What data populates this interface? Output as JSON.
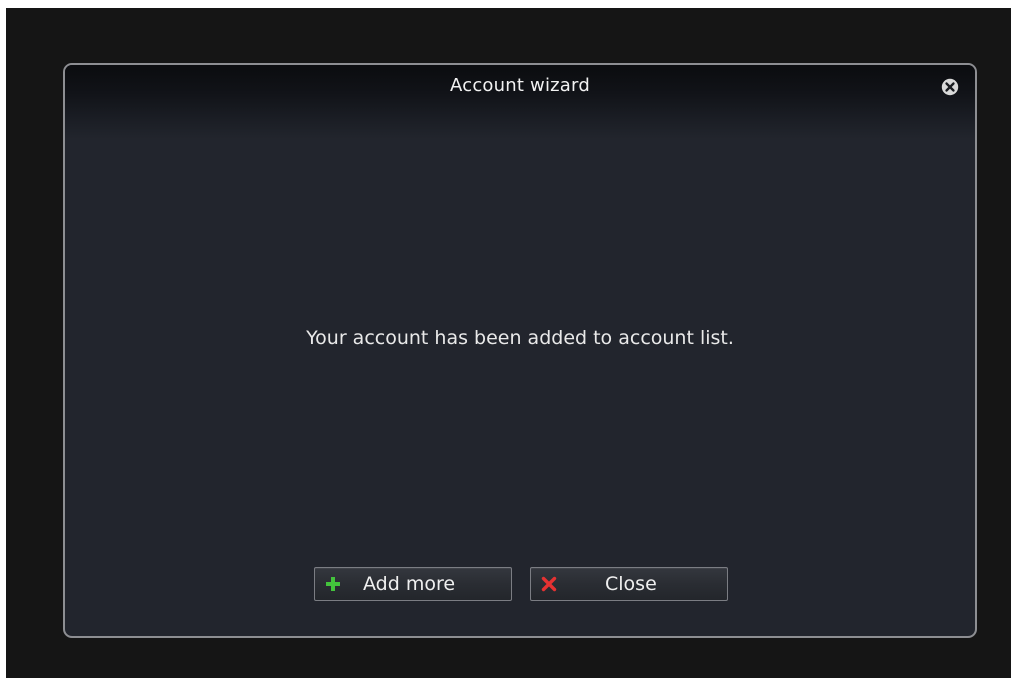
{
  "dialog": {
    "title": "Account wizard",
    "message": "Your account has been added to account list.",
    "buttons": {
      "add_more_label": "Add more",
      "close_label": "Close"
    }
  },
  "icons": {
    "title_close": "close-circle-icon",
    "add": "plus-icon",
    "close": "x-icon"
  },
  "colors": {
    "backdrop": "#151515",
    "dialog_bg": "#22252d",
    "dialog_border": "#8d8e92",
    "plus": "#43c33c",
    "x": "#e53232",
    "text": "#efefef"
  }
}
